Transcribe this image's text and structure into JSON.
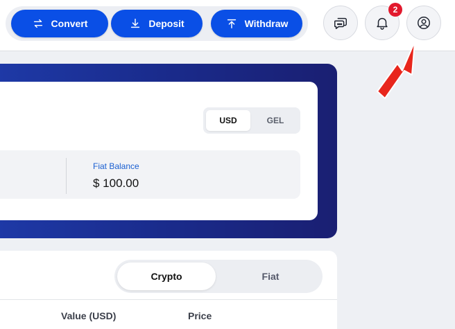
{
  "topbar": {
    "actions": {
      "convert_label": "Convert",
      "deposit_label": "Deposit",
      "withdraw_label": "Withdraw"
    },
    "notifications_count": "2",
    "icons": [
      "chat-icon",
      "bell-icon",
      "user-icon"
    ]
  },
  "balance": {
    "currency_options": [
      "USD",
      "GEL"
    ],
    "selected_currency": "USD",
    "fiat_label": "Fiat Balance",
    "fiat_value": "$ 100.00"
  },
  "assets": {
    "tabs": [
      "Crypto",
      "Fiat"
    ],
    "selected_tab": "Crypto",
    "columns": [
      "Value (USD)",
      "Price"
    ]
  },
  "colors": {
    "primary": "#0a4fe6",
    "card_gradient_start": "#1e3aa8",
    "card_gradient_end": "#1a1f72",
    "badge": "#e2192d",
    "annotation_arrow": "#e8261c",
    "link": "#1a5fd1"
  }
}
